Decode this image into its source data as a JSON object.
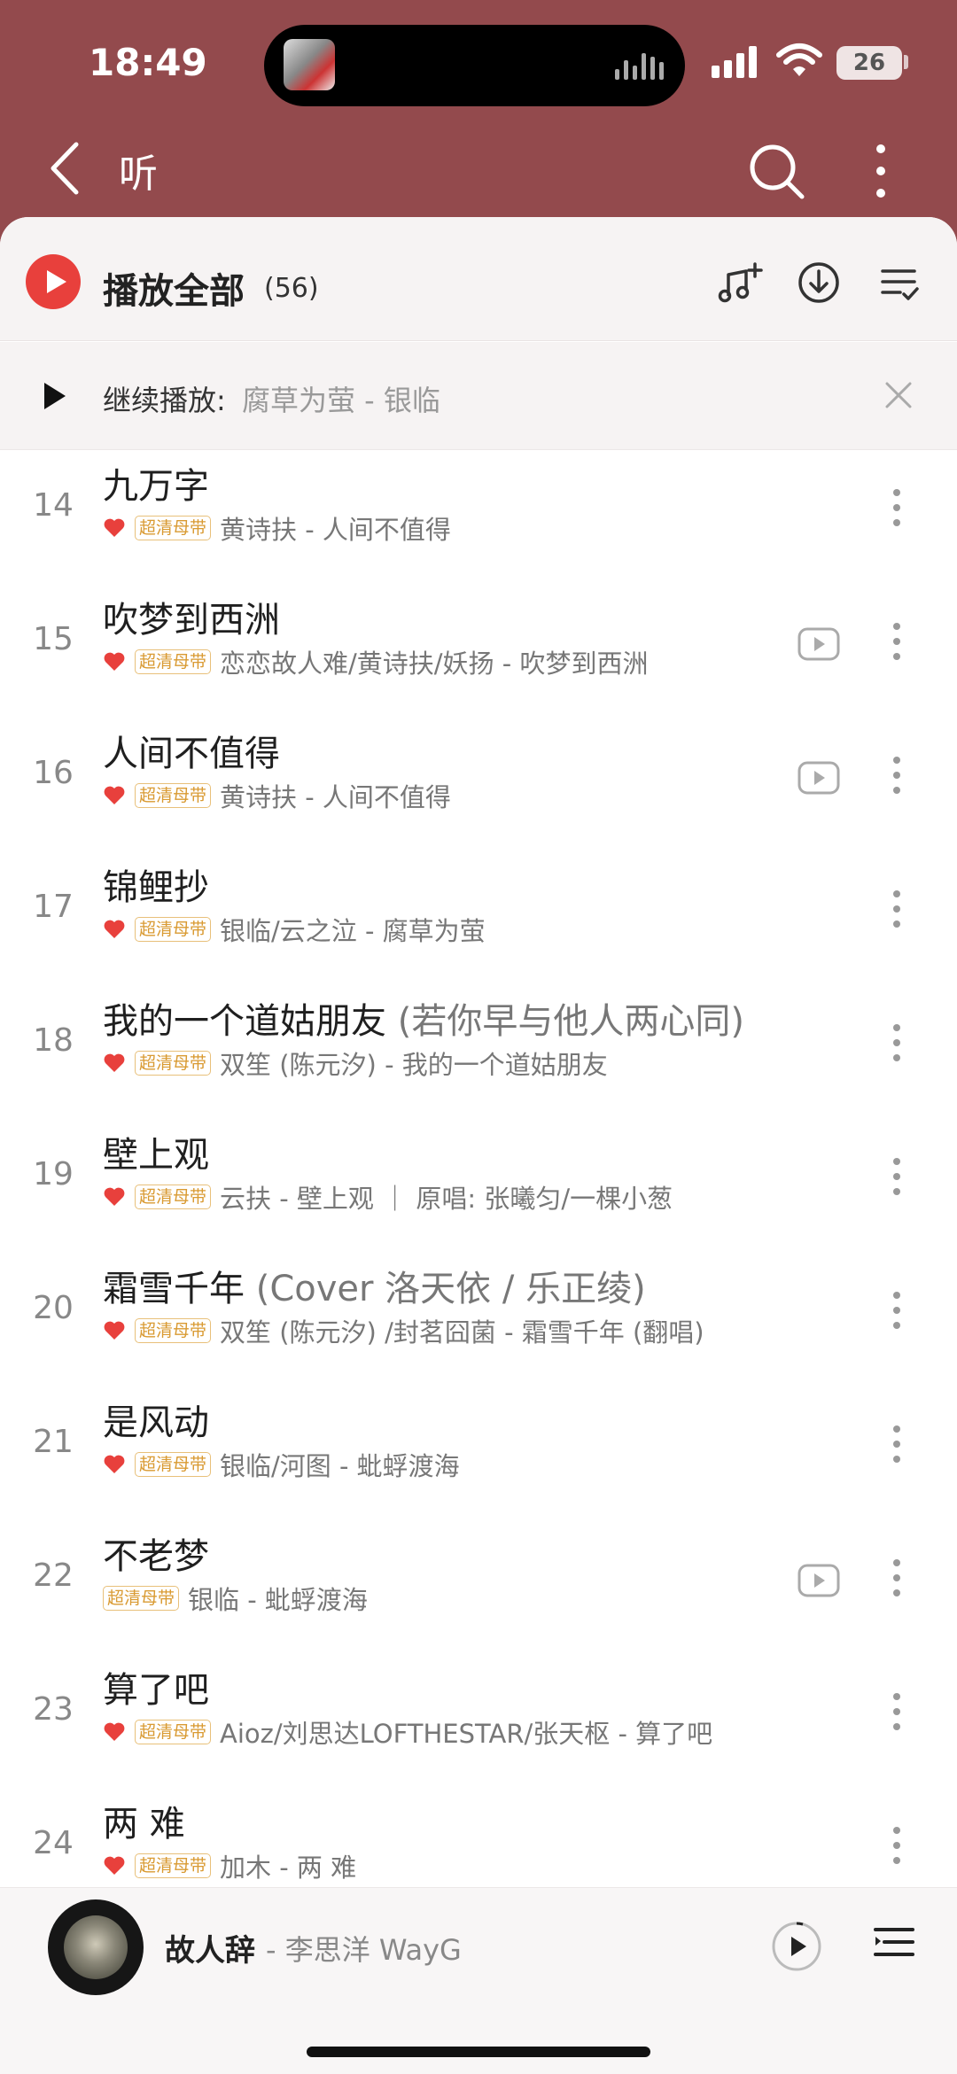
{
  "status": {
    "time": "18:49",
    "battery": "26"
  },
  "header": {
    "title": "听"
  },
  "toolbar": {
    "play_all_label": "播放全部",
    "count": "(56)"
  },
  "continue": {
    "label": "继续播放:",
    "song": "腐草为萤 - 银临"
  },
  "colors": {
    "brand": "#934a4d",
    "accent": "#e8403c",
    "badge": "#d99a32"
  },
  "songs": [
    {
      "num": "14",
      "title": "九万字",
      "sub": "",
      "liked": true,
      "badge": "超清母带",
      "artist": "黄诗扶 - 人间不值得",
      "mv": false
    },
    {
      "num": "15",
      "title": "吹梦到西洲",
      "sub": "",
      "liked": true,
      "badge": "超清母带",
      "artist": "恋恋故人难/黄诗扶/妖扬 - 吹梦到西洲",
      "mv": true
    },
    {
      "num": "16",
      "title": "人间不值得",
      "sub": "",
      "liked": true,
      "badge": "超清母带",
      "artist": "黄诗扶 - 人间不值得",
      "mv": true
    },
    {
      "num": "17",
      "title": "锦鲤抄",
      "sub": "",
      "liked": true,
      "badge": "超清母带",
      "artist": "银临/云之泣 - 腐草为萤",
      "mv": false
    },
    {
      "num": "18",
      "title": "我的一个道姑朋友",
      "sub": " (若你早与他人两心同)",
      "liked": true,
      "badge": "超清母带",
      "artist": "双笙 (陈元汐) - 我的一个道姑朋友",
      "mv": false
    },
    {
      "num": "19",
      "title": "壁上观",
      "sub": "",
      "liked": true,
      "badge": "超清母带",
      "artist": "云扶 - 壁上观 ｜ 原唱: 张曦匀/一棵小葱",
      "mv": false
    },
    {
      "num": "20",
      "title": "霜雪千年",
      "sub": " (Cover 洛天依 / 乐正绫)",
      "liked": true,
      "badge": "超清母带",
      "artist": "双笙 (陈元汐) /封茗囧菌 - 霜雪千年 (翻唱)",
      "mv": false
    },
    {
      "num": "21",
      "title": "是风动",
      "sub": "",
      "liked": true,
      "badge": "超清母带",
      "artist": "银临/河图 - 蚍蜉渡海",
      "mv": false
    },
    {
      "num": "22",
      "title": "不老梦",
      "sub": "",
      "liked": false,
      "badge": "超清母带",
      "artist": "银临 - 蚍蜉渡海",
      "mv": true
    },
    {
      "num": "23",
      "title": "算了吧",
      "sub": "",
      "liked": true,
      "badge": "超清母带",
      "artist": "Aioz/刘思达LOFTHESTAR/张天枢 - 算了吧",
      "mv": false
    },
    {
      "num": "24",
      "title": "两 难",
      "sub": "",
      "liked": true,
      "badge": "超清母带",
      "artist": "加木 - 两 难",
      "mv": false
    }
  ],
  "player": {
    "title": "故人辞",
    "artist": "- 李思洋 WayG"
  }
}
